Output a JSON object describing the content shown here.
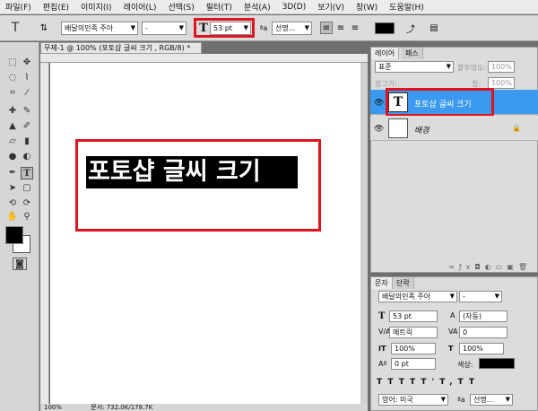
{
  "menu": [
    "파일(F)",
    "편집(E)",
    "이미지(I)",
    "레이어(L)",
    "선택(S)",
    "필터(T)",
    "분석(A)",
    "3D(D)",
    "보기(V)",
    "창(W)",
    "도움말(H)"
  ],
  "options": {
    "font_family": "배달의민족 주아",
    "font_style": "-",
    "font_size": "53 pt",
    "antialias": "선명...",
    "tool_glyph": "T"
  },
  "document": {
    "tab_title": "무제-1 @ 100% (포토샵 글씨 크기 , RGB/8) *",
    "canvas_text": "포토샵 글씨 크기",
    "zoom": "100%",
    "status": "문서: 732.0K/178.7K"
  },
  "layers_panel": {
    "tabs": [
      "레이어",
      "패스"
    ],
    "blend_mode": "표준",
    "opacity_label": "불투명도:",
    "opacity_value": "100%",
    "lock_label": "잠그기:",
    "fill_label": "칠:",
    "fill_value": "100%",
    "layers": [
      {
        "name": "포토샵 글씨 크기",
        "thumb": "T",
        "selected": true
      },
      {
        "name": "배경",
        "thumb": "",
        "selected": false
      }
    ]
  },
  "char_panel": {
    "tabs": [
      "문자",
      "단락"
    ],
    "font_family": "배달의민족 주아",
    "font_style": "-",
    "font_size": "53 pt",
    "leading": "(자동)",
    "kerning": "메트릭",
    "tracking": "0",
    "vscale": "100%",
    "hscale": "100%",
    "baseline": "0 pt",
    "color_label": "색상:",
    "language": "영어: 미국",
    "antialias": "선명..."
  },
  "colors": {
    "highlight_red": "#e0141e",
    "selected_layer": "#3b99f0",
    "text_black": "#000000",
    "text_white": "#ffffff"
  }
}
